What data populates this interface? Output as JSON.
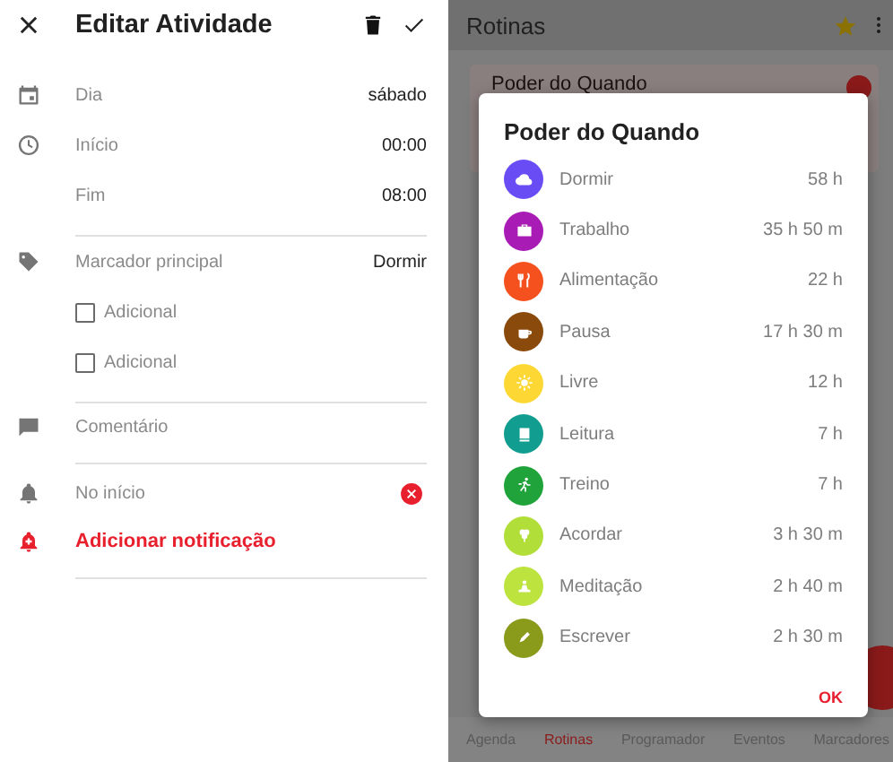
{
  "edit_screen": {
    "title": "Editar Atividade",
    "rows": [
      {
        "kind": "value",
        "label": "Dia",
        "value": "sábado"
      },
      {
        "kind": "value",
        "label": "Início",
        "value": "00:00"
      },
      {
        "kind": "value",
        "label": "Fim",
        "value": "08:00"
      },
      {
        "kind": "divider"
      },
      {
        "kind": "value",
        "label": "Marcador principal",
        "value": "Dormir"
      },
      {
        "kind": "checkbox",
        "label": "Adicional",
        "checked": false
      },
      {
        "kind": "checkbox",
        "label": "Adicional",
        "checked": false
      },
      {
        "kind": "divider"
      },
      {
        "kind": "field",
        "placeholder": "Comentário"
      },
      {
        "kind": "divider"
      },
      {
        "kind": "notification",
        "label": "No início"
      },
      {
        "kind": "action",
        "label": "Adicionar notificação"
      },
      {
        "kind": "divider"
      }
    ]
  },
  "routines_screen": {
    "title": "Rotinas",
    "card_title": "Poder do Quando",
    "dialog": {
      "title": "Poder do Quando",
      "items": [
        {
          "name": "Dormir",
          "duration": "58 h",
          "color": "#6a4cf5"
        },
        {
          "name": "Trabalho",
          "duration": "35 h 50 m",
          "color": "#a81cb5"
        },
        {
          "name": "Alimentação",
          "duration": "22 h",
          "color": "#f4511e"
        },
        {
          "name": "Pausa",
          "duration": "17 h 30 m",
          "color": "#8a4a0c"
        },
        {
          "name": "Livre",
          "duration": "12 h",
          "color": "#fdd835"
        },
        {
          "name": "Leitura",
          "duration": "7 h",
          "color": "#119d8f"
        },
        {
          "name": "Treino",
          "duration": "7 h",
          "color": "#1fa33a"
        },
        {
          "name": "Acordar",
          "duration": "3 h 30 m",
          "color": "#b2de3a"
        },
        {
          "name": "Meditação",
          "duration": "2 h 40 m",
          "color": "#bde33f"
        },
        {
          "name": "Escrever",
          "duration": "2 h 30 m",
          "color": "#8a9a1b"
        }
      ],
      "button": "OK"
    },
    "bottom_nav": [
      {
        "label": "Agenda",
        "selected": false
      },
      {
        "label": "Rotinas",
        "selected": true
      },
      {
        "label": "Programador",
        "selected": false
      },
      {
        "label": "Eventos",
        "selected": false
      },
      {
        "label": "Marcadores",
        "selected": false
      }
    ]
  }
}
